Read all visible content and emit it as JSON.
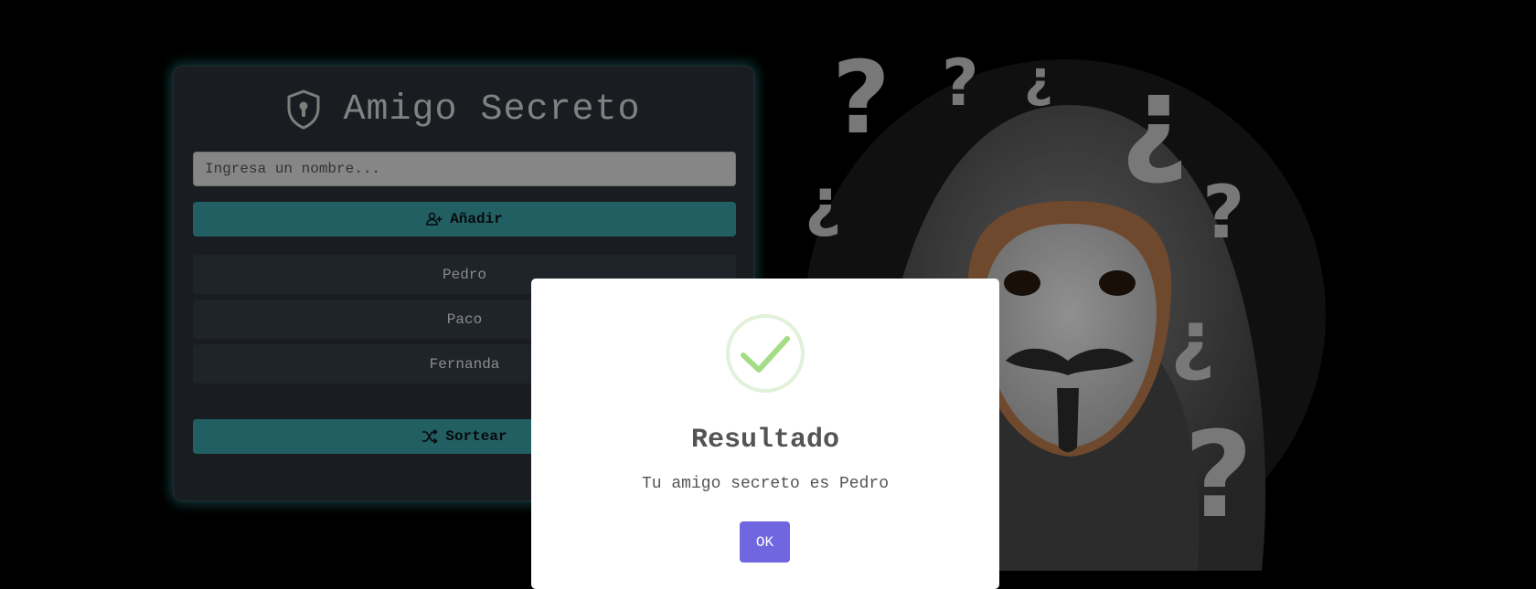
{
  "app": {
    "title": "Amigo Secreto",
    "input_placeholder": "Ingresa un nombre...",
    "add_label": "Añadir",
    "draw_label": "Sortear",
    "friends": [
      "Pedro",
      "Paco",
      "Fernanda"
    ]
  },
  "modal": {
    "title": "Resultado",
    "message": "Tu amigo secreto es Pedro",
    "ok_label": "OK"
  },
  "icons": {
    "title": "shield-keyhole-icon",
    "add": "user-plus-icon",
    "draw": "shuffle-icon",
    "result": "success-check-icon"
  },
  "colors": {
    "accent": "#3a9fa5",
    "glow": "#40c8d2",
    "confirm": "#7066e0",
    "success": "#a5dc86"
  }
}
